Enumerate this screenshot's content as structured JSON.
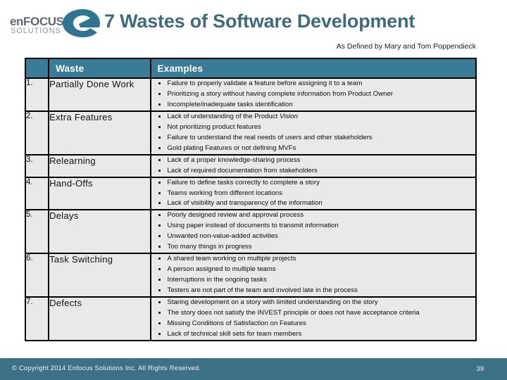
{
  "header": {
    "logo": {
      "wordmark": "enFOCUS",
      "subword": "SOLUTIONS",
      "mark_color": "#2f7490"
    },
    "title": "7 Wastes of Software Development",
    "subtitle": "As Defined by Mary and Tom Poppendieck",
    "title_color": "#3d6b7d"
  },
  "table": {
    "header_bg": "#3a7b96",
    "cell_bg": "#e9e9e9",
    "border_color": "#000000",
    "columns": [
      {
        "key": "num",
        "label": ""
      },
      {
        "key": "waste",
        "label": "Waste"
      },
      {
        "key": "examples",
        "label": "Examples"
      }
    ],
    "rows": [
      {
        "num": "1.",
        "waste": "Partially Done Work",
        "examples": [
          "Failure to properly validate a feature before assigning it to a team",
          "Prioritizing a story without having complete information from Product Owner",
          "Incomplete/inadequate tasks identification"
        ]
      },
      {
        "num": "2.",
        "waste": "Extra Features",
        "examples": [
          "Lack of understanding of the Product <em>Vision</em>",
          "Not prioritizing product features",
          "Failure to understand the real needs of users and other stakeholders",
          "Gold plating Features or not defining MVFs"
        ]
      },
      {
        "num": "3.",
        "waste": "Relearning",
        "examples": [
          "Lack of a proper knowledge-sharing process",
          "Lack of required documentation from stakeholders"
        ]
      },
      {
        "num": "4.",
        "waste": "Hand-Offs",
        "examples": [
          "Failure to define tasks correctly to complete a story",
          "Teams working from different locations",
          "Lack of visibility and transparency of the information"
        ]
      },
      {
        "num": "5.",
        "waste": "Delays",
        "examples": [
          "Poorly designed review and approval process",
          "Using paper instead of documents to transmit information",
          "Unwanted non-value-added activities",
          "Too many things in progress"
        ]
      },
      {
        "num": "6.",
        "waste": "Task Switching",
        "examples": [
          "A shared team working on multiple projects",
          "A person assigned to multiple teams",
          "Interruptions in the ongoing tasks",
          "Testers are not part of the team and involved late in the process"
        ]
      },
      {
        "num": "7.",
        "waste": "Defects",
        "examples": [
          "Staring development on a story with limited understanding on the story",
          "The story does not satisfy the INVEST principle or does not have acceptance criteria",
          "Missing Conditions of Satisfaction on Features",
          "Lack of technical skill sets for team members"
        ]
      }
    ]
  },
  "footer": {
    "copyright": "© Copyright 2014 Enfocus Solutions Inc. All Rights Reserved.",
    "page_number": "39",
    "bg_color": "#3d7187"
  }
}
